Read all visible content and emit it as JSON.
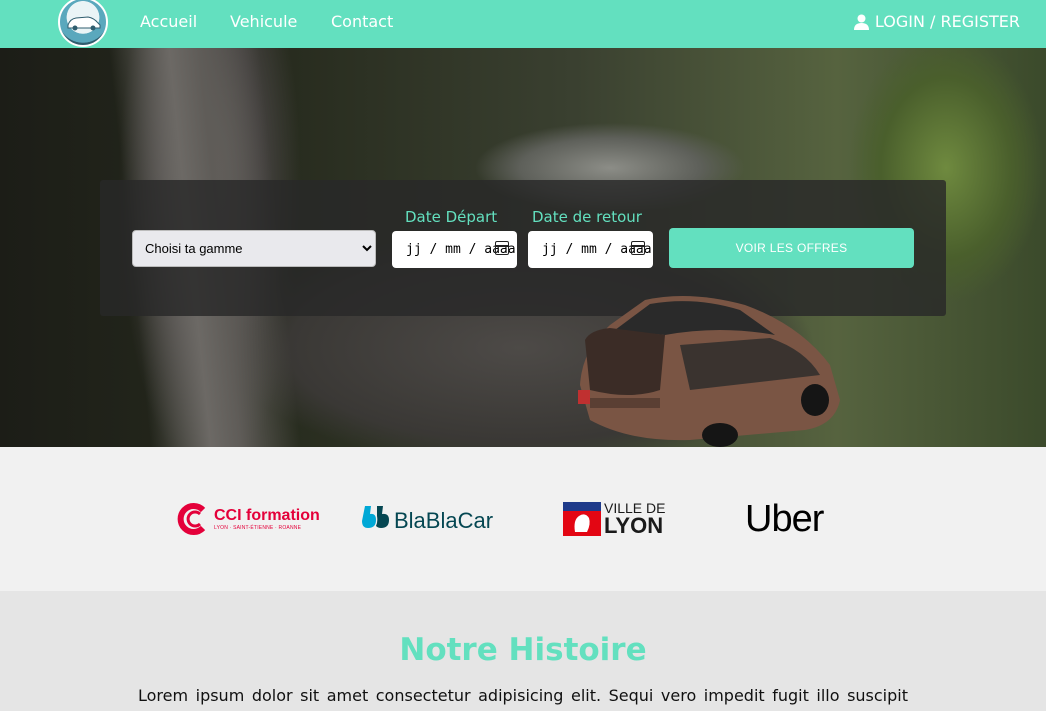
{
  "nav": {
    "items": [
      "Accueil",
      "Vehicule",
      "Contact"
    ],
    "login_label": "LOGIN / REGISTER"
  },
  "search": {
    "select_value": "Choisi ta gamme",
    "depart_label": "Date Départ",
    "retour_label": "Date de retour",
    "date_placeholder": "jj / mm / aaaa",
    "button_label": "VOIR LES OFFRES"
  },
  "partners": {
    "cci_title": "CCI formation",
    "cci_sub": "LYON · SAINT-ÉTIENNE · ROANNE",
    "blablacar": "BlaBlaCar",
    "lyon_top": "VILLE DE",
    "lyon_bottom": "LYON",
    "uber": "Uber"
  },
  "story": {
    "title": "Notre Histoire",
    "text": "Lorem ipsum dolor sit amet consectetur adipisicing elit. Sequi vero impedit fugit illo suscipit"
  },
  "colors": {
    "accent": "#63e0bf",
    "cci": "#e4003a",
    "blablacar": "#054752",
    "lyon_red": "#e30613"
  }
}
